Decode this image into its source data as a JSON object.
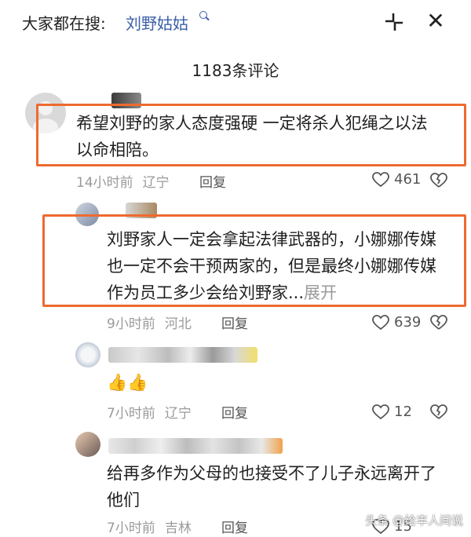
{
  "header": {
    "search_prefix": "大家都在搜:",
    "search_query": "刘野姑姑",
    "collapse_icon": "collapse-arrows-icon",
    "close_icon": "close-icon",
    "close_glyph": "✕"
  },
  "comments_title": "1183条评论",
  "comments": [
    {
      "text": "希望刘野的家人态度强硬 一定将杀人犯绳之以法 以命相陪。",
      "time": "14小时前",
      "location": "辽宁",
      "reply": "回复",
      "likes": "461"
    },
    {
      "text": "刘野家人一定会拿起法律武器的，小娜娜传媒也一定不会干预两家的，但是最终小娜娜传媒作为员工多少会给刘野家...",
      "expand": "展开",
      "time": "9小时前",
      "location": "河北",
      "reply": "回复",
      "likes": "639"
    },
    {
      "text": "👍👍",
      "time": "7小时前",
      "location": "辽宁",
      "reply": "回复",
      "likes": "12"
    },
    {
      "text": "给再多作为父母的也接受不了儿子永远离开了他们",
      "time": "7小时前",
      "location": "吉林",
      "reply": "回复",
      "likes": "15"
    }
  ],
  "watermark": "头条 @给丰人间说",
  "colors": {
    "highlight": "#ee6a2f",
    "link": "#3b5fa8",
    "meta": "#9a9a9a"
  }
}
